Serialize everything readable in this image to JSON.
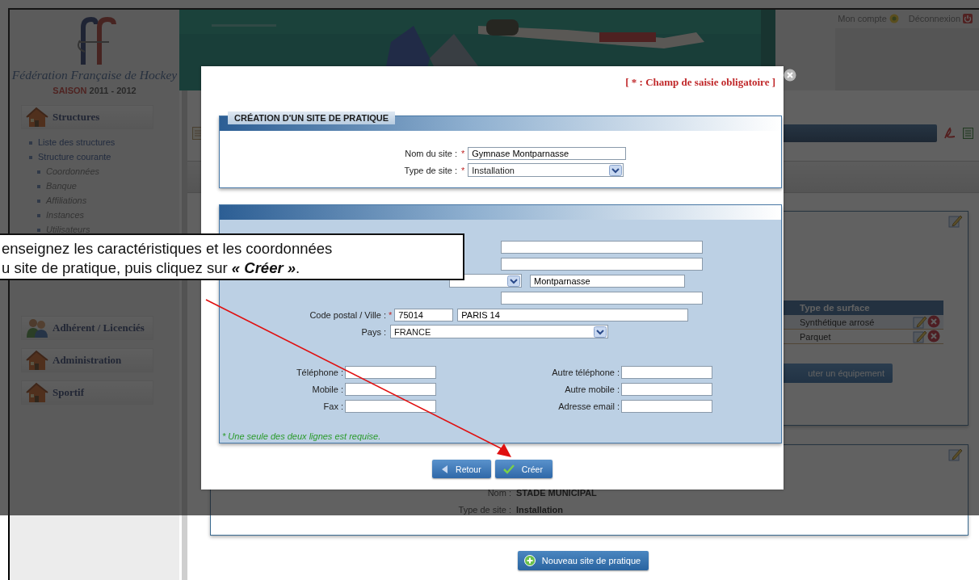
{
  "header": {
    "org_name": "Fédération Française de Hockey",
    "season_label": "SAISON",
    "season_years": "2011 - 2012",
    "account_link": "Mon compte",
    "logout_link": "Déconnexion"
  },
  "sidebar": {
    "sections": [
      {
        "label": "Structures",
        "kind": "house",
        "items": [
          {
            "label": "Liste des structures"
          },
          {
            "label": "Structure courante",
            "children": [
              {
                "label": "Coordonnées"
              },
              {
                "label": "Banque"
              },
              {
                "label": "Affiliations"
              },
              {
                "label": "Instances"
              },
              {
                "label": "Utilisateurs"
              }
            ]
          }
        ]
      },
      {
        "label": "Adhérent / Licenciés",
        "kind": "people"
      },
      {
        "label": "Administration",
        "kind": "house"
      },
      {
        "label": "Sportif",
        "kind": "house"
      }
    ]
  },
  "main": {
    "equipment_table": {
      "columns": [
        "Type de surface"
      ],
      "rows": [
        [
          "Synthétique arrosé"
        ],
        [
          "Parquet"
        ]
      ]
    },
    "add_equipment_button": "uter un équipement",
    "site_card": {
      "fields": [
        {
          "label": "Nom :",
          "value": "STADE MUNICIPAL"
        },
        {
          "label": "Type de site :",
          "value": "Installation"
        }
      ]
    },
    "new_site_button": "Nouveau site de pratique"
  },
  "modal": {
    "required_note": "[ * : Champ de saisie obligatoire ]",
    "section_title": "CRÉATION D'UN SITE DE PRATIQUE",
    "site_fields": [
      {
        "label": "Nom du site :",
        "required_mark": "*",
        "kind": "text",
        "value": "Gymnase Montparnasse"
      },
      {
        "label": "Type de site :",
        "required_mark": "*",
        "kind": "select",
        "value": "Installation"
      }
    ],
    "address_rows": [
      {
        "kind": "text"
      },
      {
        "kind": "text"
      },
      {
        "kind": "select_text",
        "value": "Montparnasse"
      },
      {
        "kind": "text"
      },
      {
        "kind": "postal",
        "label": "Code postal / Ville :",
        "required_mark": "*",
        "value": "75014",
        "city": "PARIS 14"
      },
      {
        "kind": "select",
        "label": "Pays :",
        "value": "FRANCE"
      }
    ],
    "contact_fields": [
      {
        "label": "Téléphone :"
      },
      {
        "label": "Autre téléphone :"
      },
      {
        "label": "Mobile :"
      },
      {
        "label": "Autre mobile :"
      },
      {
        "label": "Fax :"
      },
      {
        "label": "Adresse email :"
      }
    ],
    "footnote": "* Une seule des deux lignes est requise.",
    "buttons": [
      {
        "label": "Retour",
        "kind": "back"
      },
      {
        "label": "Créer",
        "kind": "confirm"
      }
    ]
  },
  "callout": {
    "text": "enseignez les caractéristiques et les coordonnées\nu site de pratique, puis cliquez sur **« Créer »**."
  }
}
